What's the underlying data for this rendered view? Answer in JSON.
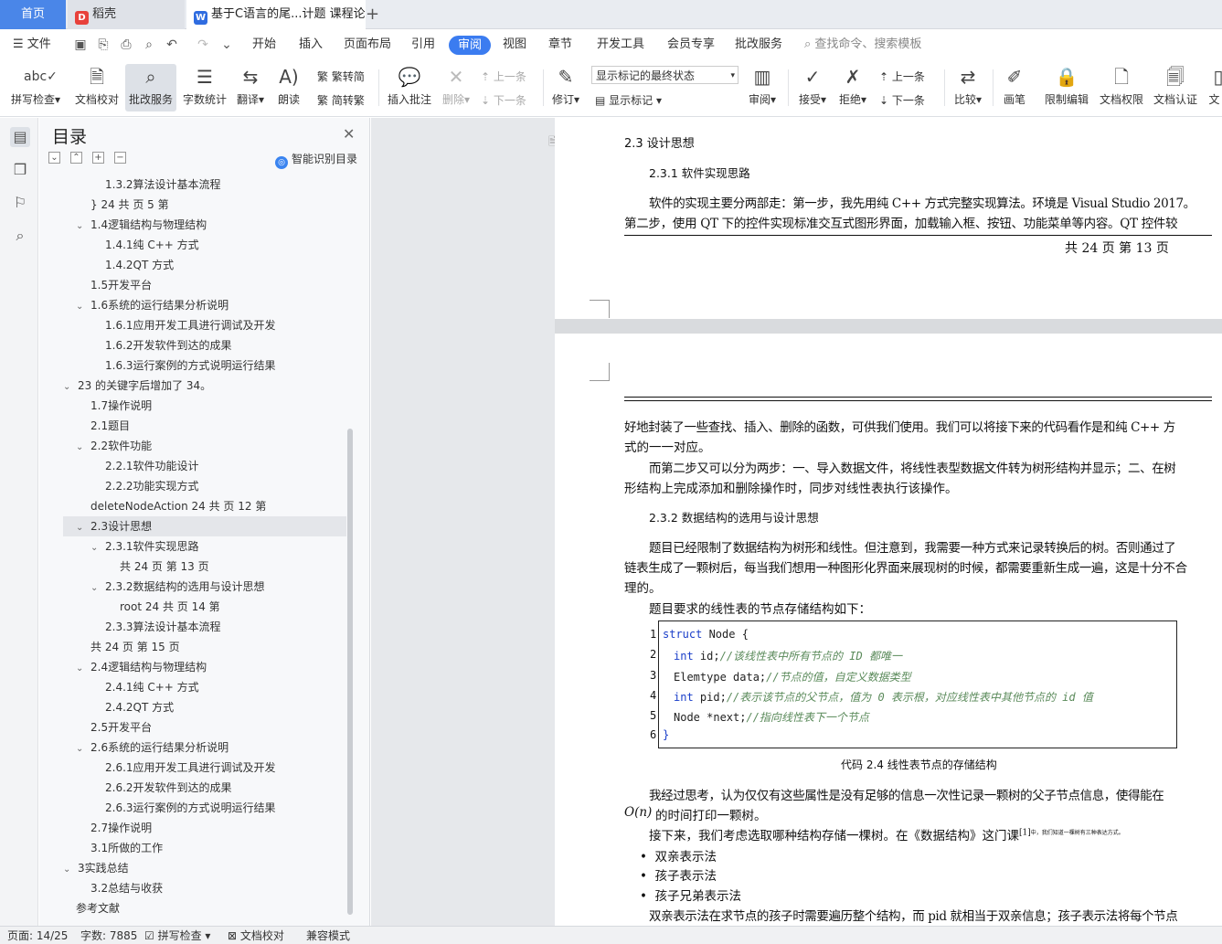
{
  "tabs": {
    "home": "首页",
    "daoke": "稻壳",
    "doc": "基于C语言的尾...计题 课程论文",
    "new_tab": "+"
  },
  "menu": {
    "file": "文件",
    "items": [
      "开始",
      "插入",
      "页面布局",
      "引用",
      "审阅",
      "视图",
      "章节",
      "开发工具",
      "会员专享",
      "批改服务"
    ],
    "active": "审阅",
    "search": "查找命令、搜索模板"
  },
  "ribbon": {
    "spell": "拼写检查",
    "doc_check": "文档校对",
    "correction": "批改服务",
    "word_count": "字数统计",
    "translate": "翻译",
    "read": "朗读",
    "trad": "繁转简",
    "simp": "简转繁",
    "insert_comment": "插入批注",
    "delete": "删除",
    "prev": "上一条",
    "next": "下一条",
    "track": "修订",
    "markup_select": "显示标记的最终状态",
    "show_markup": "显示标记",
    "review": "审阅",
    "accept": "接受",
    "reject": "拒绝",
    "prev2": "上一条",
    "next2": "下一条",
    "compare": "比较",
    "pen": "画笔",
    "restrict": "限制编辑",
    "rights": "文档权限",
    "cert": "文档认证",
    "more": "文"
  },
  "toc": {
    "title": "目录",
    "smart": "智能识别目录",
    "items": [
      {
        "text": "1.3.2算法设计基本流程",
        "level": 2,
        "arrow": ""
      },
      {
        "text": "} 24  共  页 5 第",
        "level": 1,
        "arrow": ""
      },
      {
        "text": "1.4逻辑结构与物理结构",
        "level": 1,
        "arrow": "v"
      },
      {
        "text": "1.4.1纯 C++ 方式",
        "level": 2,
        "arrow": ""
      },
      {
        "text": "1.4.2QT 方式",
        "level": 2,
        "arrow": ""
      },
      {
        "text": "1.5开发平台",
        "level": 1,
        "arrow": ""
      },
      {
        "text": "1.6系统的运行结果分析说明",
        "level": 1,
        "arrow": "v"
      },
      {
        "text": "1.6.1应用开发工具进行调试及开发",
        "level": 2,
        "arrow": ""
      },
      {
        "text": "1.6.2开发软件到达的成果",
        "level": 2,
        "arrow": ""
      },
      {
        "text": "1.6.3运行案例的方式说明运行结果",
        "level": 2,
        "arrow": ""
      },
      {
        "text": "23 的关键字后增加了 34。",
        "level": 0,
        "arrow": "v"
      },
      {
        "text": "1.7操作说明",
        "level": 1,
        "arrow": ""
      },
      {
        "text": "2.1题目",
        "level": 1,
        "arrow": ""
      },
      {
        "text": "2.2软件功能",
        "level": 1,
        "arrow": "v"
      },
      {
        "text": "2.2.1软件功能设计",
        "level": 2,
        "arrow": ""
      },
      {
        "text": "2.2.2功能实现方式",
        "level": 2,
        "arrow": ""
      },
      {
        "text": "deleteNodeAction  24  共  页 12 第",
        "level": 1,
        "arrow": ""
      },
      {
        "text": "2.3设计思想",
        "level": 1,
        "arrow": "v",
        "selected": true
      },
      {
        "text": "2.3.1软件实现思路",
        "level": 2,
        "arrow": "v"
      },
      {
        "text": "共 24  页  第 13 页",
        "level": 3,
        "arrow": ""
      },
      {
        "text": "2.3.2数据结构的选用与设计思想",
        "level": 2,
        "arrow": "v"
      },
      {
        "text": "root  24  共  页 14 第",
        "level": 3,
        "arrow": ""
      },
      {
        "text": "2.3.3算法设计基本流程",
        "level": 2,
        "arrow": ""
      },
      {
        "text": "共 24  页  第 15 页",
        "level": 1,
        "arrow": ""
      },
      {
        "text": "2.4逻辑结构与物理结构",
        "level": 1,
        "arrow": "v"
      },
      {
        "text": "2.4.1纯 C++ 方式",
        "level": 2,
        "arrow": ""
      },
      {
        "text": "2.4.2QT 方式",
        "level": 2,
        "arrow": ""
      },
      {
        "text": "2.5开发平台",
        "level": 1,
        "arrow": ""
      },
      {
        "text": "2.6系统的运行结果分析说明",
        "level": 1,
        "arrow": "v"
      },
      {
        "text": "2.6.1应用开发工具进行调试及开发",
        "level": 2,
        "arrow": ""
      },
      {
        "text": "2.6.2开发软件到达的成果",
        "level": 2,
        "arrow": ""
      },
      {
        "text": "2.6.3运行案例的方式说明运行结果",
        "level": 2,
        "arrow": ""
      },
      {
        "text": "2.7操作说明",
        "level": 1,
        "arrow": ""
      },
      {
        "text": "3.1所做的工作",
        "level": 1,
        "arrow": ""
      },
      {
        "text": "3实践总结",
        "level": 0,
        "arrow": "v"
      },
      {
        "text": "3.2总结与收获",
        "level": 1,
        "arrow": ""
      },
      {
        "text": "参考文献",
        "level": 0,
        "arrow": ""
      }
    ]
  },
  "doc": {
    "h_2_3": "2.3 设计思想",
    "h_2_3_1": "2.3.1  软件实现思路",
    "p1_l1": "软件的实现主要分两部走：第一步，我先用纯  C++ 方式完整实现算法。环境是  Visual Studio 2017。",
    "p1_l2": "第二步，使用  QT 下的控件实现标准交互式图形界面，加载输入框、按钮、功能菜单等内容。QT 控件较",
    "footer": "共   24   页     第   13   页",
    "p2_l1": "好地封装了一些查找、插入、删除的函数，可供我们使用。我们可以将接下来的代码看作是和纯  C++ 方",
    "p2_l2": "式的一一对应。",
    "p3_l1": "而第二步又可以分为两步：一、导入数据文件，将线性表型数据文件转为树形结构并显示；二、在树",
    "p3_l2": "形结构上完成添加和删除操作时，同步对线性表执行该操作。",
    "h_2_3_2": "2.3.2  数据结构的选用与设计思想",
    "p4_l1": "题目已经限制了数据结构为树形和线性。但注意到，我需要一种方式来记录转换后的树。否则通过了",
    "p4_l2": "链表生成了一颗树后，每当我们想用一种图形化界面来展现树的时候，都需要重新生成一遍，这是十分不合",
    "p4_l3": "理的。",
    "p5": "题目要求的线性表的节点存储结构如下：",
    "code_caption": "代码  2.4 线性表节点的存储结构",
    "p6_l1": "我经过思考，认为仅仅有这些属性是没有足够的信息一次性记录一颗树的父子节点信息，使得能在",
    "p6_l2": "的时间打印一颗树。",
    "big_o": "O(n)",
    "p7": "接下来，我们考虑选取哪种结构存储一棵树。在《数据结构》这门课",
    "p7_ref": "[1]",
    "p7_note": "中，我们知道一棵树有三种表达方式。",
    "bullets": [
      "双亲表示法",
      "孩子表示法",
      "孩子兄弟表示法"
    ],
    "p8": "双亲表示法在求节点的孩子时需要遍历整个结构，而  pid 就相当于双亲信息；孩子表示法将每个节点"
  },
  "code": {
    "line_numbers": [
      "1",
      "2",
      "3",
      "4",
      "5",
      "6"
    ],
    "l1_kw": "struct",
    "l1_rest": " Node {",
    "l2_kw": "int",
    "l2_rest": " id;",
    "l2_cm": "//该线性表中所有节点的 ID 都唯一",
    "l3_rest": "Elemtype data;",
    "l3_cm": "//节点的值，自定义数据类型",
    "l4_kw": "int",
    "l4_rest": " pid;",
    "l4_cm": "//表示该节点的父节点，值为 0 表示根，对应线性表中其他节点的 id 值",
    "l5_rest": "Node *next;",
    "l5_cm": "//指向线性表下一个节点",
    "l6": "}"
  },
  "status": {
    "page": "页面: 14/25",
    "words": "字数: 7885",
    "spell": "拼写检查",
    "doc_check": "文档校对",
    "compat": "兼容模式"
  },
  "colors": {
    "accent": "#3b7cf0",
    "home_tab": "#4a86e8"
  }
}
